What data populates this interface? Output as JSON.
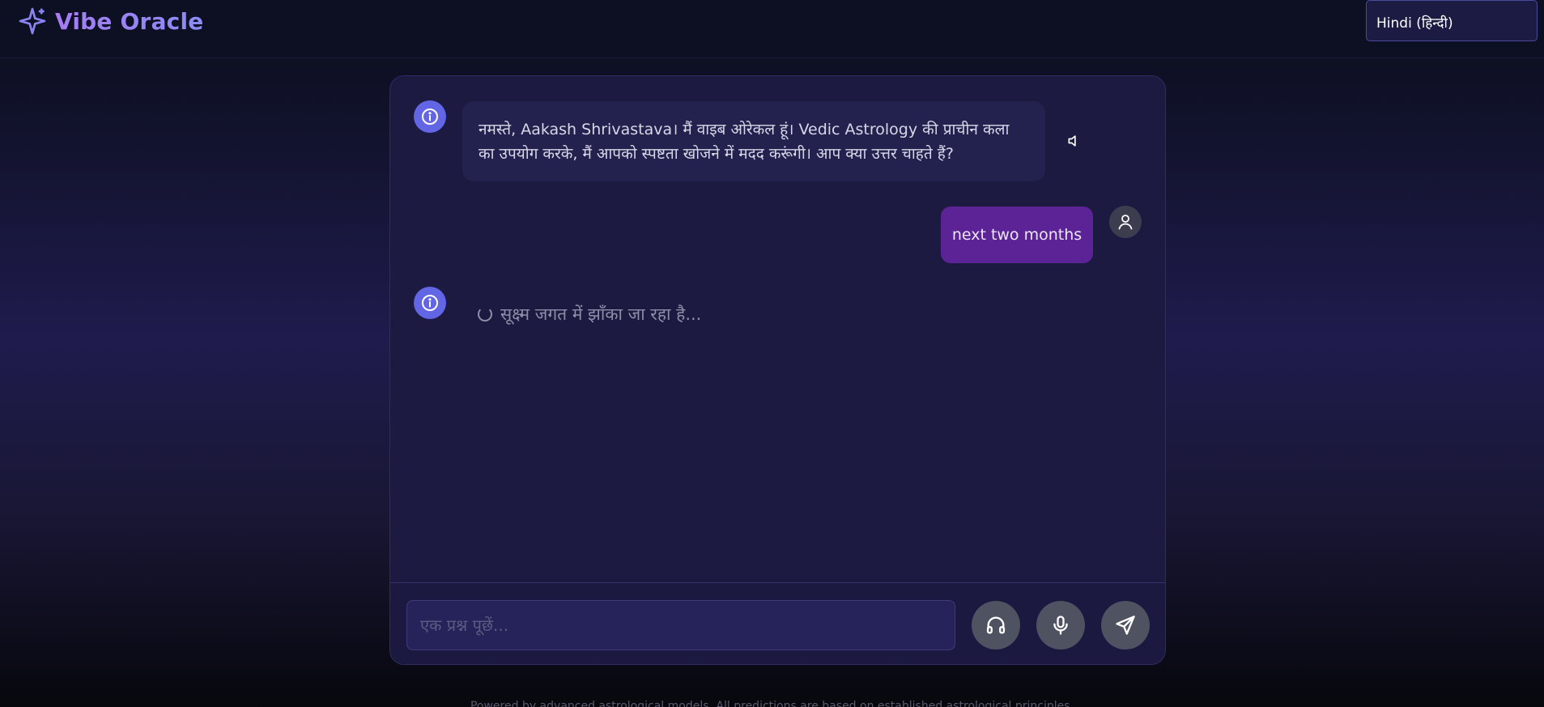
{
  "header": {
    "brand": "Vibe Oracle",
    "logo_icon": "sparkle-icon",
    "language_select": "Hindi (हिन्दी)"
  },
  "chat": {
    "messages": [
      {
        "role": "bot",
        "avatar_icon": "info-icon",
        "line1": "नमस्ते, Aakash Shrivastava। मैं वाइब ओरेकल हूं। Vedic Astrology की प्राचीन कला",
        "line2": "का उपयोग करके, मैं आपको स्पष्टता खोजने में मदद करूंगी। आप क्या उत्तर चाहते हैं?",
        "speaker_icon": "speaker-icon"
      },
      {
        "role": "user",
        "avatar_icon": "user-icon",
        "text": "next two months"
      },
      {
        "role": "bot",
        "avatar_icon": "info-icon",
        "loading_text": "सूक्ष्म जगत में झाँका जा रहा है..."
      }
    ]
  },
  "input": {
    "placeholder": "एक प्रश्न पूछें...",
    "value": "",
    "buttons": [
      {
        "name": "headphones-button",
        "icon": "headphones-icon"
      },
      {
        "name": "microphone-button",
        "icon": "microphone-icon"
      },
      {
        "name": "send-button",
        "icon": "send-icon"
      }
    ]
  },
  "footer": {
    "text": "Powered by advanced astrological models. All predictions are based on established astrological principles."
  },
  "colors": {
    "brand_gradient_start": "#a77cf5",
    "brand_gradient_end": "#8b8cf5",
    "bot_avatar": "#6266e4",
    "user_bubble": "#5b2396",
    "card_bg": "#1c1a40"
  }
}
